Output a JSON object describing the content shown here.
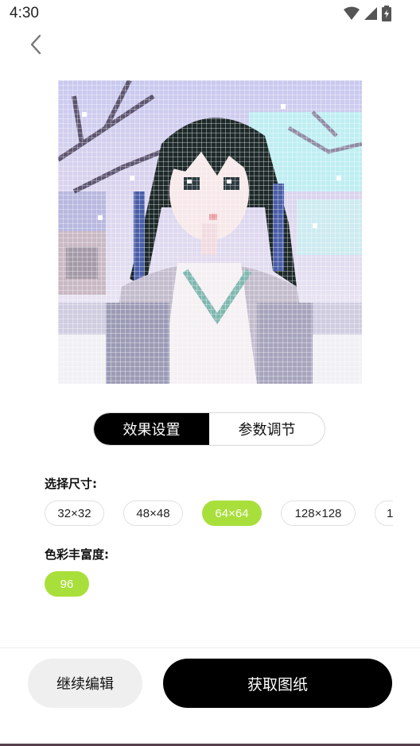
{
  "status_bar": {
    "time": "4:30"
  },
  "tabs": [
    {
      "label": "效果设置",
      "active": true
    },
    {
      "label": "参数调节",
      "active": false
    }
  ],
  "size_section": {
    "label": "选择尺寸:",
    "options": [
      "32×32",
      "48×48",
      "64×64",
      "128×128",
      "1"
    ],
    "selected_index": 2
  },
  "color_section": {
    "label": "色彩丰富度:",
    "options": [
      "96"
    ],
    "selected_index": 0
  },
  "footer": {
    "continue_label": "继续编辑",
    "get_label": "获取图纸"
  },
  "colors": {
    "accent": "#a9df3a",
    "primary_button": "#000000",
    "secondary_button": "#efefef"
  }
}
